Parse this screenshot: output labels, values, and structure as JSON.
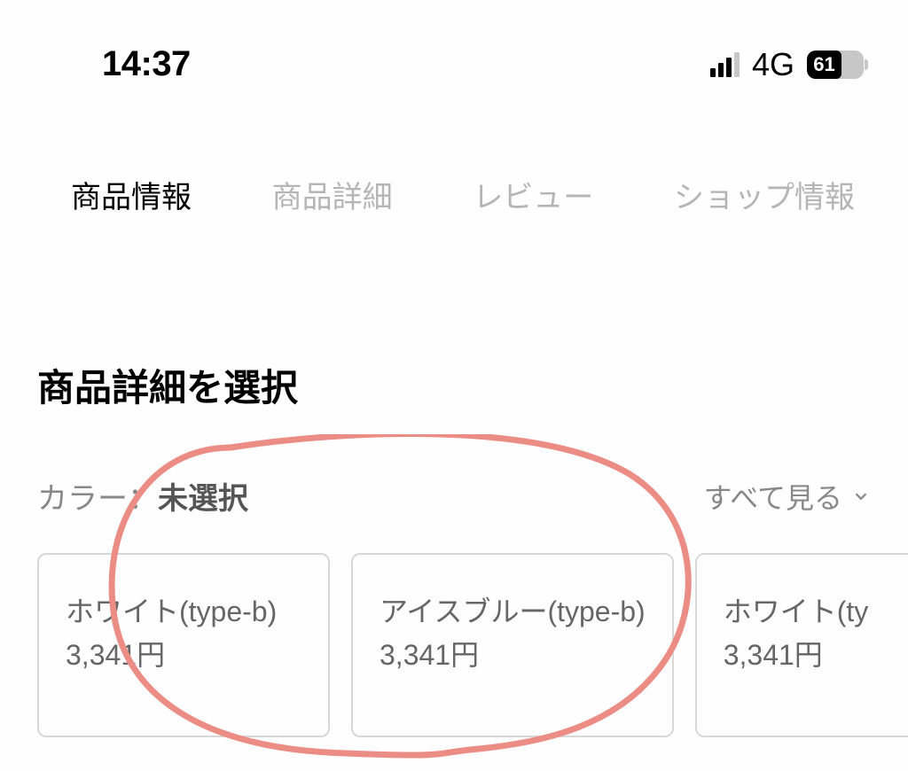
{
  "status_bar": {
    "time": "14:37",
    "network": "4G",
    "battery_percent": "61"
  },
  "tabs": [
    {
      "label": "商品情報",
      "active": true
    },
    {
      "label": "商品詳細",
      "active": false
    },
    {
      "label": "レビュー",
      "active": false
    },
    {
      "label": "ショップ情報",
      "active": false
    }
  ],
  "section_title": "商品詳細を選択",
  "color_selector": {
    "label": "カラー：",
    "selected": "未選択",
    "view_all": "すべて見る"
  },
  "options": [
    {
      "name": "ホワイト(type-b)",
      "price": "3,341円"
    },
    {
      "name": "アイスブルー(type-b)",
      "price": "3,341円"
    },
    {
      "name": "ホワイト(ty",
      "price": "3,341円"
    }
  ]
}
